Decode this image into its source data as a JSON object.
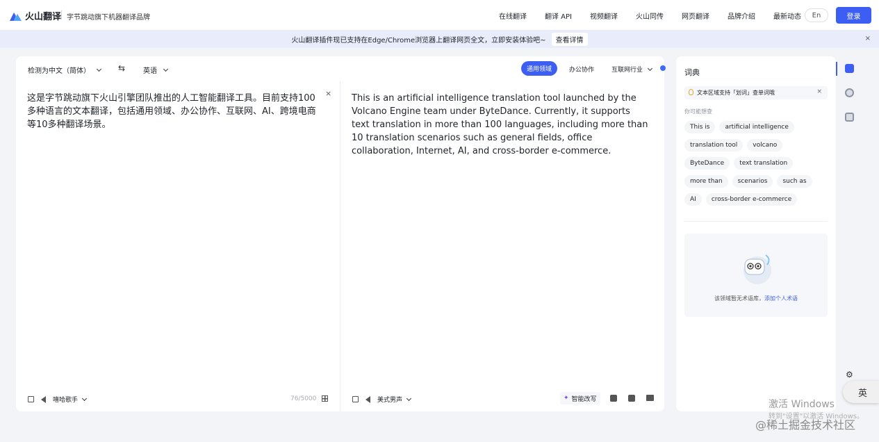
{
  "header": {
    "logo_text": "火山翻译",
    "slogan": "字节跳动旗下机器翻译品牌",
    "nav": [
      "在线翻译",
      "翻译 API",
      "视频翻译",
      "火山同传",
      "网页翻译",
      "品牌介绍",
      "最新动态"
    ],
    "lang_button": "En",
    "login_button": "登录"
  },
  "banner": {
    "text": "火山翻译插件现已支持在Edge/Chrome浏览器上翻译网页全文，立即安装体验吧~",
    "link": "查看详情",
    "close": "×"
  },
  "translator": {
    "source_lang": "检测为中文（简体）",
    "swap": "⇆",
    "target_lang": "英语",
    "domains": {
      "active": "通用领域",
      "office": "办公协作",
      "internet": "互联网行业"
    },
    "source_text": "这是字节跳动旗下火山引擎团队推出的人工智能翻译工具。目前支持100多种语言的文本翻译，包括通用领域、办公协作、互联网、AI、跨境电商等10多种翻译场景。",
    "clear": "×",
    "target_text": "This is an artificial intelligence translation tool launched by the Volcano Engine team under ByteDance. Currently, it supports text translation in more than 100 languages, including more than 10 translation scenarios such as general fields, office collaboration, Internet, AI, and cross-border e-commerce.",
    "source_voice": "嘻哈歌手",
    "char_count": "76/5000",
    "target_voice": "美式男声",
    "rewrite": "智能改写"
  },
  "dictionary": {
    "title": "词典",
    "tip": "文本区域支持「划词」查单词哦",
    "tip_close": "×",
    "maybe_label": "你可能想查",
    "chips": [
      "This is",
      "artificial intelligence",
      "translation tool",
      "volcano",
      "ByteDance",
      "text translation",
      "more than",
      "scenarios",
      "such as",
      "AI",
      "cross-border e-commerce"
    ],
    "empty_text": "该领域暂无术语库，",
    "empty_link": "添加个人术语"
  },
  "system": {
    "ime": "英",
    "watermark_line1": "激活 Windows",
    "watermark_line2": "转到\"设置\"以激活 Windows。",
    "watermark_site": "@稀土掘金技术社区"
  },
  "colors": {
    "accent": "#3c5ef3",
    "banner_bg": "#e9edfb",
    "page_bg": "#f3f4f7"
  }
}
